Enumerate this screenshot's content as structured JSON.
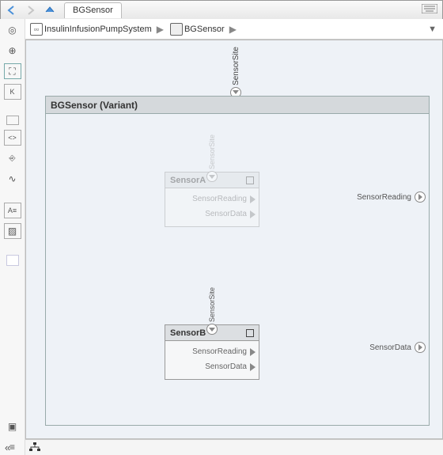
{
  "toolbar": {
    "tab_label": "BGSensor"
  },
  "breadcrumb": {
    "root": "InsulinInfusionPumpSystem",
    "current": "BGSensor"
  },
  "block": {
    "title": "BGSensor  (Variant)",
    "top_port": "SensorSite",
    "out_ports": [
      {
        "label": "SensorReading"
      },
      {
        "label": "SensorData"
      }
    ]
  },
  "sub_blocks": [
    {
      "name": "SensorA",
      "active": false,
      "top_port": "SensorSite",
      "outputs": [
        "SensorReading",
        "SensorData"
      ]
    },
    {
      "name": "SensorB",
      "active": true,
      "top_port": "SensorSite",
      "outputs": [
        "SensorReading",
        "SensorData"
      ]
    }
  ],
  "icons": {
    "back": "back-arrow",
    "forward": "forward-arrow",
    "up": "up-arrow",
    "keyboard": "keyboard-icon",
    "hierarchy": "hierarchy-icon",
    "collapse": "collapse-icon"
  }
}
